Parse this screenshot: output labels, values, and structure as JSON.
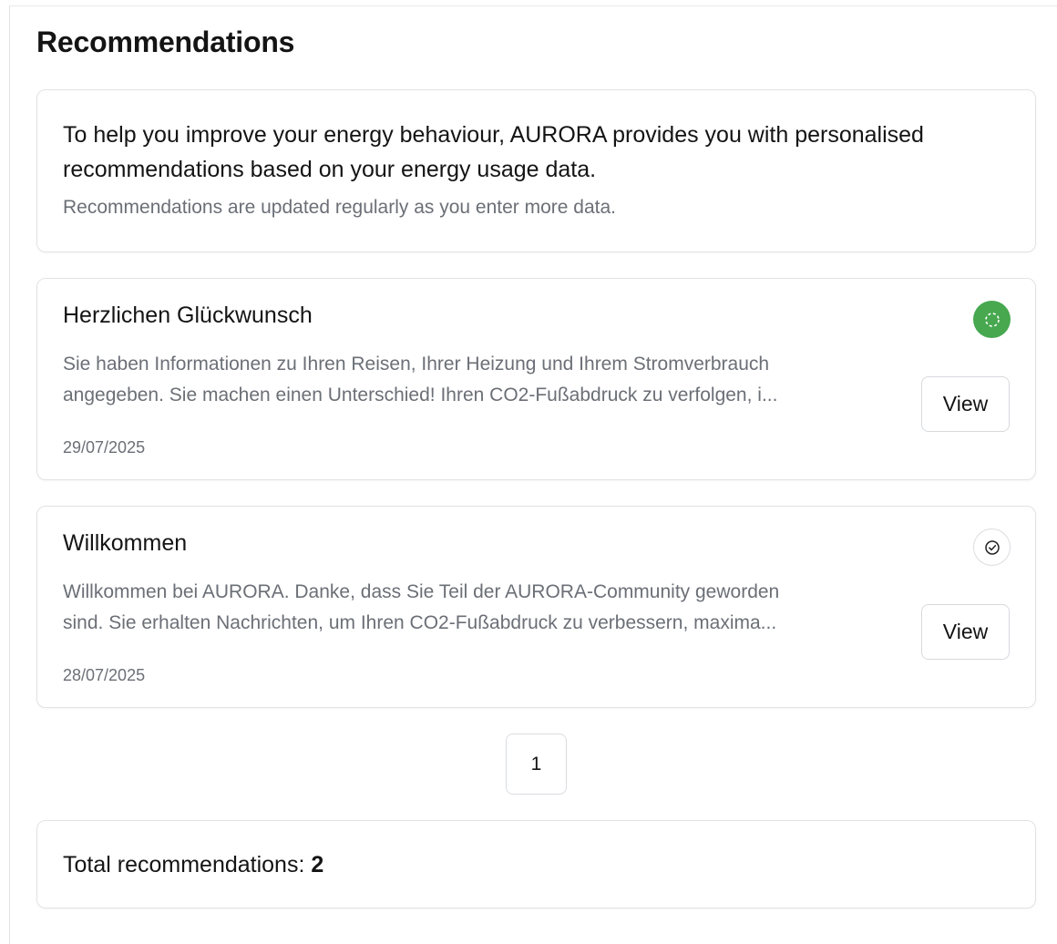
{
  "page": {
    "title": "Recommendations"
  },
  "intro": {
    "lead": "To help you improve your energy behaviour, AURORA provides you with personalised recommendations based on your energy usage data.",
    "sub": "Recommendations are updated regularly as you enter more data."
  },
  "recommendations": [
    {
      "title": "Herzlichen Glückwunsch",
      "body_line1": "Sie haben Informationen zu Ihren Reisen, Ihrer Heizung und Ihrem Stromverbrauch",
      "body_line2": "angegeben. Sie machen einen Unterschied! Ihren CO2-Fußabdruck zu verfolgen, i...",
      "date": "29/07/2025",
      "status_icon": "dashed-circle-icon",
      "status_color": "#47a84f",
      "view_label": "View"
    },
    {
      "title": "Willkommen",
      "body_line1": "Willkommen bei AURORA. Danke, dass Sie Teil der AURORA-Community geworden",
      "body_line2": "sind. Sie erhalten Nachrichten, um Ihren CO2-Fußabdruck zu verbessern, maxima...",
      "date": "28/07/2025",
      "status_icon": "check-circle-icon",
      "status_color": "#ffffff",
      "view_label": "View"
    }
  ],
  "pagination": {
    "current_page": "1"
  },
  "summary": {
    "total_label": "Total recommendations: ",
    "total_count": "2"
  }
}
